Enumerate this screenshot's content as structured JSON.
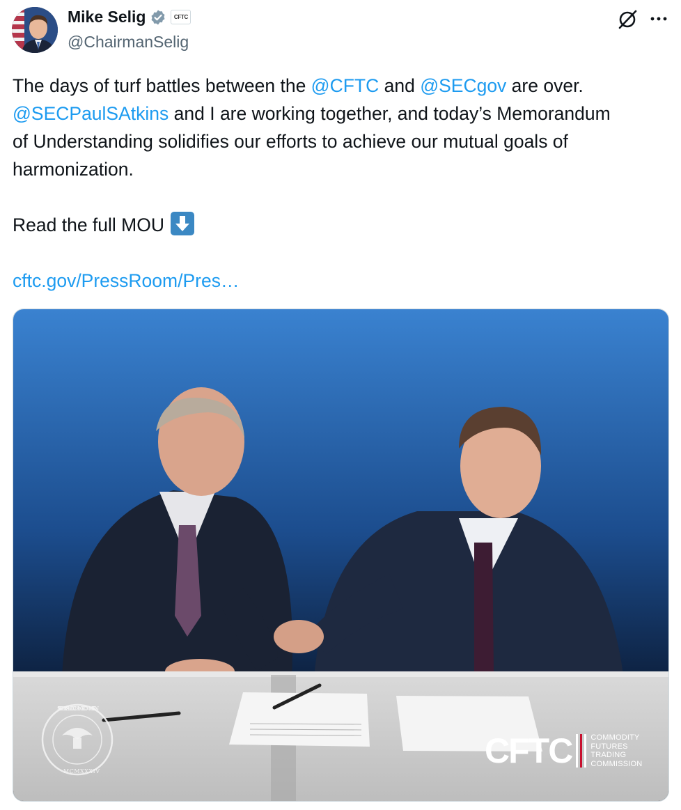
{
  "author": {
    "display_name": "Mike Selig",
    "handle": "@ChairmanSelig",
    "affiliation_badge": "CFTC",
    "verified_color": "#829aab"
  },
  "tweet": {
    "line1": {
      "t1": "The days of turf battles between the ",
      "m1": "@CFTC",
      "t2": " and ",
      "m2": "@SECgov",
      "t3": " are over."
    },
    "line2": {
      "m1": "@SECPaulSAtkins",
      "t1": " and I are working together, and today’s Memorandum"
    },
    "line3": "of Understanding solidifies our efforts to achieve our mutual goals of",
    "line4": "harmonization.",
    "read_more": "Read the full MOU",
    "read_more_emoji": "down-arrow-emoji",
    "link": "cftc.gov/PressRoom/Pres…",
    "link_color": "#1d9bf0"
  },
  "media": {
    "logo_word": "CFTC",
    "logo_sub": [
      "COMMODITY",
      "FUTURES",
      "TRADING",
      "COMMISSION"
    ],
    "seal_text": "U.S. SECURITIES AND EXCHANGE COMMISSION",
    "seal_year": "MCMXXXIV",
    "background_color": "#2a5ea8"
  },
  "icons": [
    "verified-badge-icon",
    "grok-icon",
    "more-icon"
  ]
}
